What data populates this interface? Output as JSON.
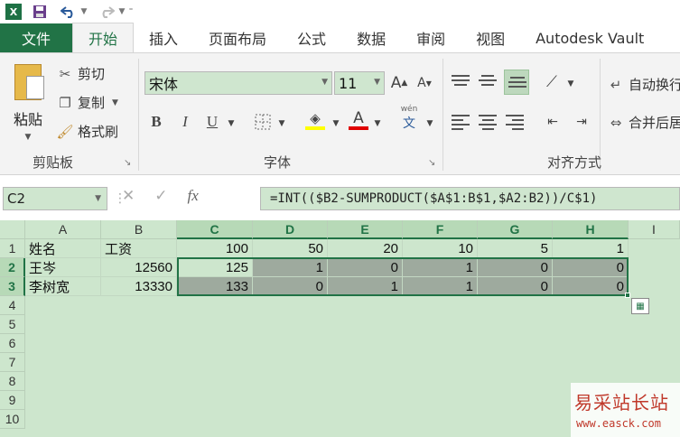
{
  "qat": {
    "app_icon": "X",
    "save_icon": "save-icon",
    "undo_icon": "undo-icon",
    "redo_icon": "redo-icon"
  },
  "tabs": [
    "文件",
    "开始",
    "插入",
    "页面布局",
    "公式",
    "数据",
    "审阅",
    "视图",
    "Autodesk Vault"
  ],
  "active_tab": "开始",
  "clipboard": {
    "paste": "粘贴",
    "cut": "剪切",
    "copy": "复制",
    "format_painter": "格式刷",
    "group": "剪贴板"
  },
  "font": {
    "name": "宋体",
    "size": "11",
    "bold": "B",
    "italic": "I",
    "underline": "U",
    "color_letter": "A",
    "phonetic": "文",
    "phonetic_top": "wén",
    "group": "字体",
    "grow": "A",
    "shrink": "A"
  },
  "alignment": {
    "wrap": "自动换行",
    "merge": "合并后居中",
    "group": "对齐方式"
  },
  "formula_bar": {
    "name_box": "C2",
    "fx": "fx",
    "formula": "=INT(($B2-SUMPRODUCT($A$1:B$1,$A2:B2))/C$1)"
  },
  "columns": [
    "A",
    "B",
    "C",
    "D",
    "E",
    "F",
    "G",
    "H",
    "I"
  ],
  "rows": [
    "1",
    "2",
    "3",
    "4",
    "5",
    "6",
    "7",
    "8",
    "9",
    "10"
  ],
  "sheet": {
    "row1": [
      "姓名",
      "工资",
      "100",
      "50",
      "20",
      "10",
      "5",
      "1"
    ],
    "row2": [
      "王岑",
      "12560",
      "125",
      "1",
      "0",
      "1",
      "0",
      "0"
    ],
    "row3": [
      "李树宽",
      "13330",
      "133",
      "0",
      "1",
      "1",
      "0",
      "0"
    ]
  },
  "watermark": {
    "title": "易采站长站",
    "url": "www.easck.com"
  },
  "colors": {
    "accent": "#217346",
    "sheet_bg": "#cde6cd",
    "selection": "#9eaa9e",
    "watermark": "#c0392b"
  }
}
